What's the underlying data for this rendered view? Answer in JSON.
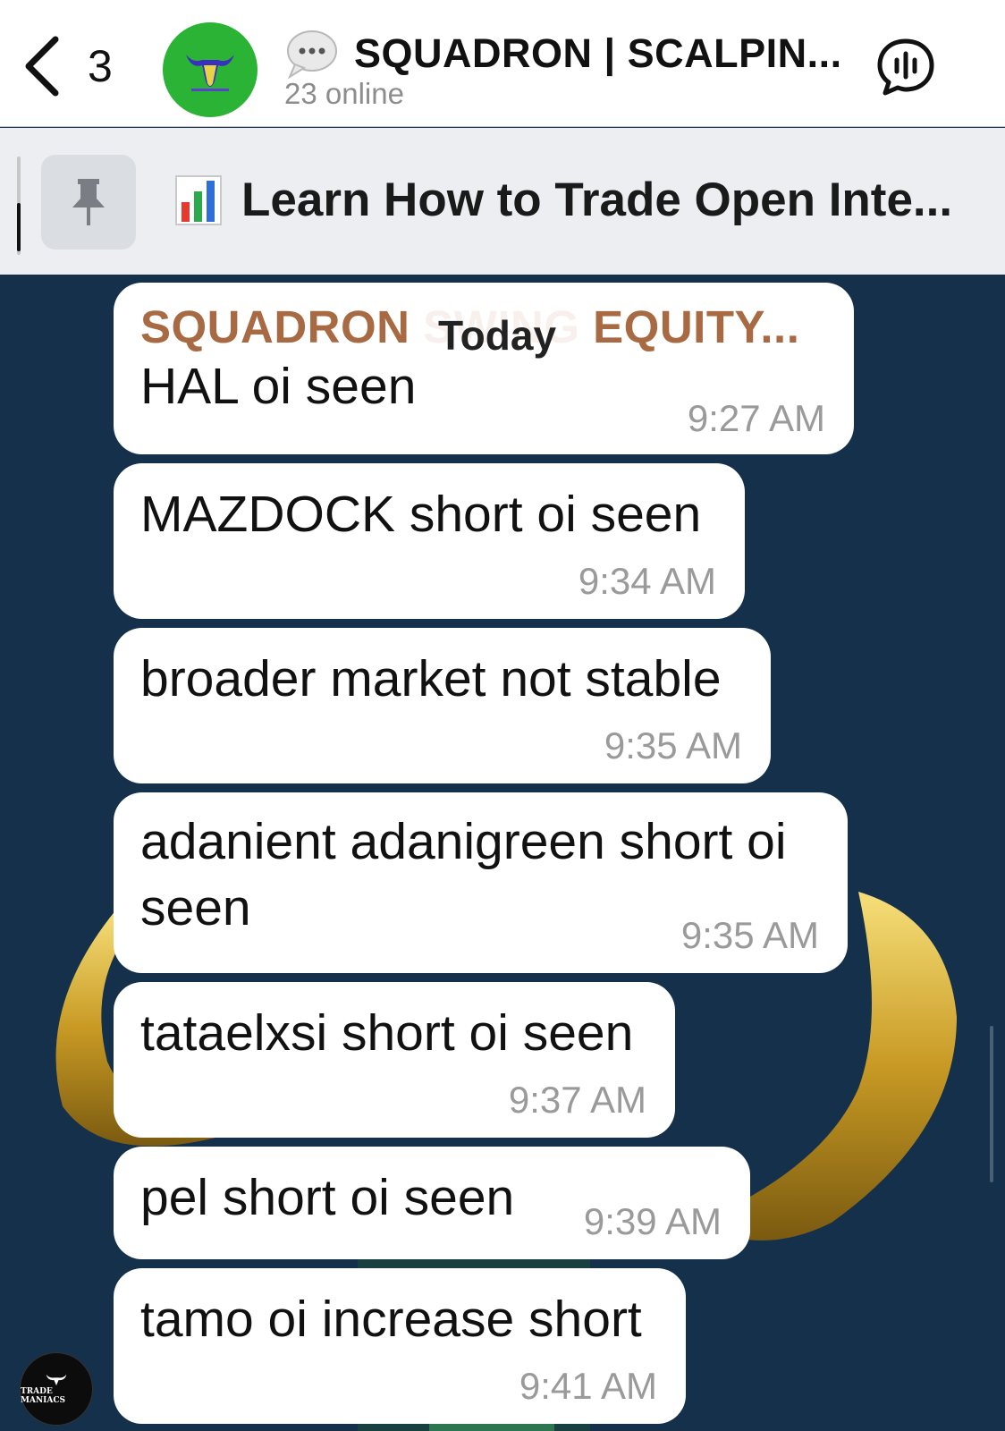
{
  "header": {
    "back_count": "3",
    "title": "SQUADRON | SCALPIN...",
    "subtitle": "23 online",
    "icons": [
      "chevron-left-icon",
      "chat-bubble-icon",
      "voice-chat-icon"
    ]
  },
  "pinned": {
    "text": "Learn How to Trade Open Inte...",
    "icons": [
      "pin-icon",
      "bar-chart-emoji"
    ]
  },
  "date_pill": "Today",
  "messages": [
    {
      "sender": "SQUADRON SWING EQUITY...",
      "text": "HAL oi seen",
      "time": "9:27 AM"
    },
    {
      "text": "MAZDOCK short oi seen",
      "time": "9:34 AM"
    },
    {
      "text": "broader market not stable",
      "time": "9:35 AM"
    },
    {
      "text": "adanient adanigreen short oi seen",
      "time": "9:35 AM"
    },
    {
      "text": "tataelxsi short oi seen",
      "time": "9:37 AM"
    },
    {
      "text": "pel short oi seen",
      "time": "9:39 AM"
    },
    {
      "text": "tamo oi increase short",
      "time": "9:41 AM"
    }
  ],
  "watermark": {
    "text": "TRADE MANIACS"
  },
  "colors": {
    "chat_bg": "#14304a",
    "sender": "#a86a42",
    "avatar": "#2bb336"
  }
}
